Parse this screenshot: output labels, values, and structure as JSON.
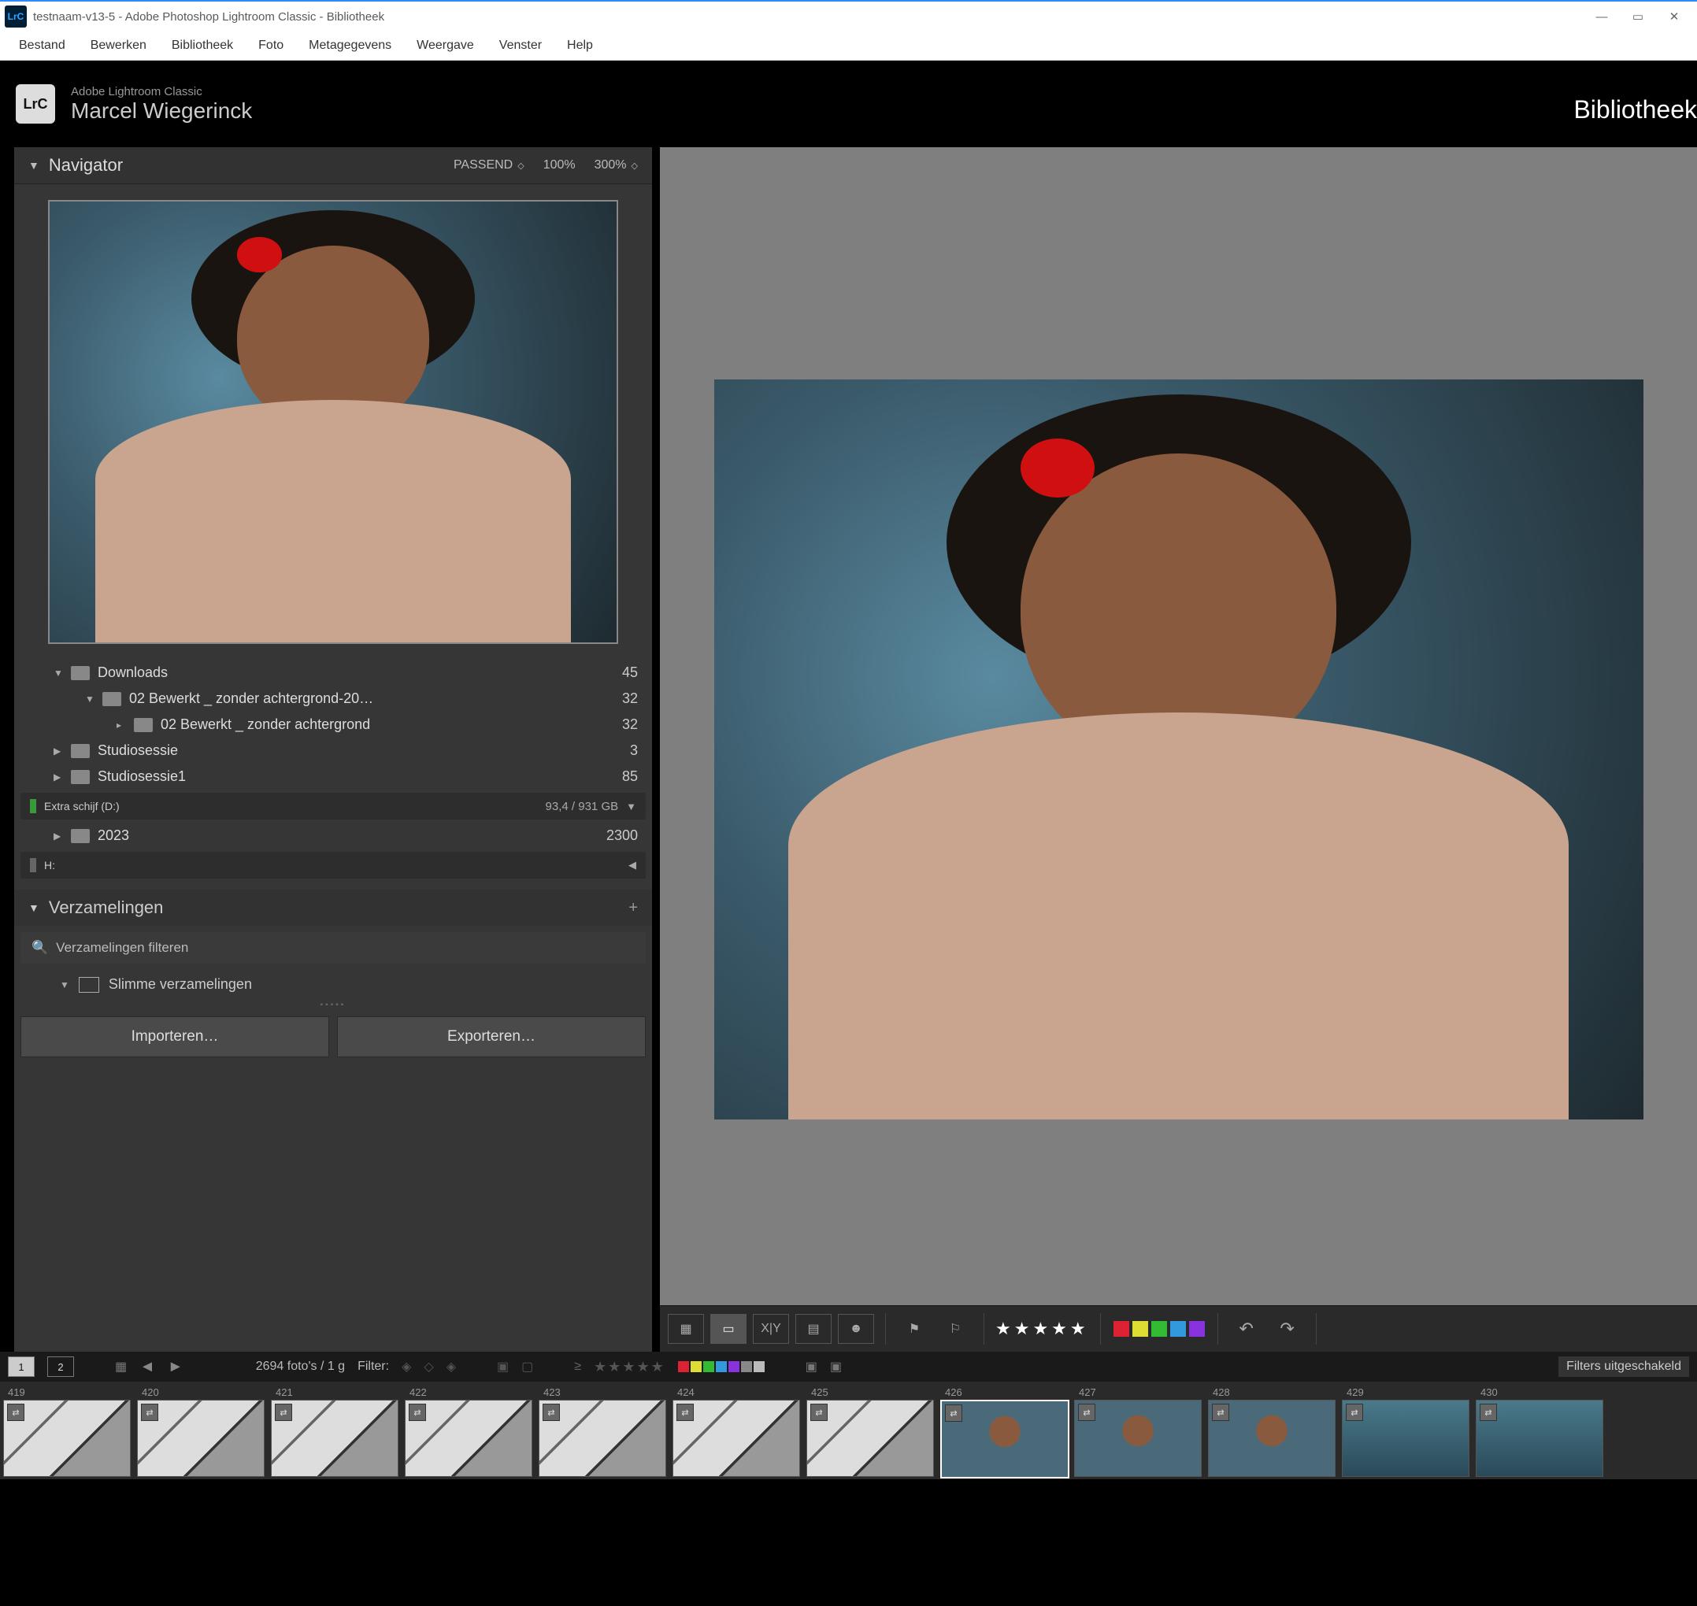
{
  "window": {
    "title": "testnaam-v13-5 - Adobe Photoshop Lightroom Classic - Bibliotheek",
    "logo_text": "LrC"
  },
  "menubar": [
    "Bestand",
    "Bewerken",
    "Bibliotheek",
    "Foto",
    "Metagegevens",
    "Weergave",
    "Venster",
    "Help"
  ],
  "brand": {
    "logo": "LrC",
    "product": "Adobe Lightroom Classic",
    "user": "Marcel Wiegerinck",
    "module": "Bibliotheek"
  },
  "navigator": {
    "title": "Navigator",
    "fit": "PASSEND",
    "zoom1": "100%",
    "zoom2": "300%"
  },
  "folders": {
    "rows": [
      {
        "indent": 1,
        "arrow": "▼",
        "name": "Downloads",
        "count": "45"
      },
      {
        "indent": 2,
        "arrow": "▼",
        "name": "02 Bewerkt _ zonder achtergrond-20…",
        "count": "32"
      },
      {
        "indent": 3,
        "arrow": "▸",
        "name": "02 Bewerkt _ zonder achtergrond",
        "count": "32"
      },
      {
        "indent": 1,
        "arrow": "▶",
        "name": "Studiosessie",
        "count": "3"
      },
      {
        "indent": 1,
        "arrow": "▶",
        "name": "Studiosessie1",
        "count": "85"
      }
    ],
    "volume_d": {
      "name": "Extra schijf (D:)",
      "cap": "93,4 / 931 GB"
    },
    "d_rows": [
      {
        "indent": 1,
        "arrow": "▶",
        "name": "2023",
        "count": "2300"
      }
    ],
    "volume_h": {
      "name": "H:"
    }
  },
  "collections": {
    "title": "Verzamelingen",
    "search_placeholder": "Verzamelingen filteren",
    "smart": "Slimme verzamelingen"
  },
  "buttons": {
    "import": "Importeren…",
    "export": "Exporteren…"
  },
  "toolbar": {
    "stars": "★★★★★",
    "colors": [
      "#d23",
      "#dd3",
      "#3b3",
      "#39d",
      "#83d"
    ]
  },
  "filterbar": {
    "view1": "1",
    "view2": "2",
    "count_text": "2694 foto's / 1 g",
    "filter_label": "Filter:",
    "filters_off": "Filters uitgeschakeld",
    "colors": [
      "#d23",
      "#dd3",
      "#3b3",
      "#39d",
      "#83d",
      "#888",
      "#bbb"
    ]
  },
  "filmstrip": [
    {
      "n": "419",
      "type": "street"
    },
    {
      "n": "420",
      "type": "street"
    },
    {
      "n": "421",
      "type": "street"
    },
    {
      "n": "422",
      "type": "street"
    },
    {
      "n": "423",
      "type": "street"
    },
    {
      "n": "424",
      "type": "street"
    },
    {
      "n": "425",
      "type": "street"
    },
    {
      "n": "426",
      "type": "portrait-th",
      "sel": true
    },
    {
      "n": "427",
      "type": "portrait-th"
    },
    {
      "n": "428",
      "type": "portrait-th"
    },
    {
      "n": "429",
      "type": "water-th"
    },
    {
      "n": "430",
      "type": "water-th"
    }
  ]
}
